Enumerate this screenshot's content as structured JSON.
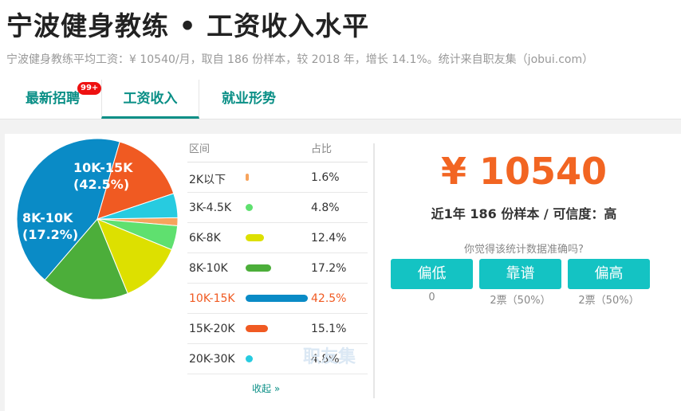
{
  "page": {
    "title": "宁波健身教练 • 工资收入水平",
    "subtitle": "宁波健身教练平均工资：¥ 10540/月，取自 186 份样本，较 2018 年，增长 14.1%。统计来自职友集（jobui.com）"
  },
  "tabs": [
    {
      "label": "最新招聘",
      "badge": "99+"
    },
    {
      "label": "工资收入"
    },
    {
      "label": "就业形势"
    }
  ],
  "chart_data": {
    "type": "pie",
    "slices": [
      {
        "label": "2K以下",
        "value": 1.6,
        "color": "#f7a35c"
      },
      {
        "label": "3K-4.5K",
        "value": 4.8,
        "color": "#5fe06f"
      },
      {
        "label": "6K-8K",
        "value": 12.4,
        "color": "#dde000"
      },
      {
        "label": "8K-10K",
        "value": 17.2,
        "color": "#4cae3a"
      },
      {
        "label": "10K-15K",
        "value": 42.5,
        "color": "#0a8bc6"
      },
      {
        "label": "15K-20K",
        "value": 15.1,
        "color": "#f05a22"
      },
      {
        "label": "20K-30K",
        "value": 4.8,
        "color": "#27cbe0"
      }
    ],
    "pie_labels": [
      {
        "name": "10K-15K",
        "pct": "(42.5%)"
      },
      {
        "name": "8K-10K",
        "pct": "(17.2%)"
      }
    ]
  },
  "legend": {
    "header_range": "区间",
    "header_pct": "占比",
    "rows": [
      {
        "range": "2K以下",
        "pct": "1.6%"
      },
      {
        "range": "3K-4.5K",
        "pct": "4.8%"
      },
      {
        "range": "6K-8K",
        "pct": "12.4%"
      },
      {
        "range": "8K-10K",
        "pct": "17.2%"
      },
      {
        "range": "10K-15K",
        "pct": "42.5%",
        "highlight": true
      },
      {
        "range": "15K-20K",
        "pct": "15.1%"
      },
      {
        "range": "20K-30K",
        "pct": "4.8%"
      }
    ],
    "collapse": "收起 »"
  },
  "watermark": "职友集",
  "summary": {
    "amount": "¥ 10540",
    "sample": "近1年 186 份样本 / 可信度：高",
    "question": "你觉得该统计数据准确吗?",
    "votes": [
      {
        "label": "偏低",
        "count": "0"
      },
      {
        "label": "靠谱",
        "count": "2票（50%）"
      },
      {
        "label": "偏高",
        "count": "2票（50%）"
      }
    ]
  }
}
